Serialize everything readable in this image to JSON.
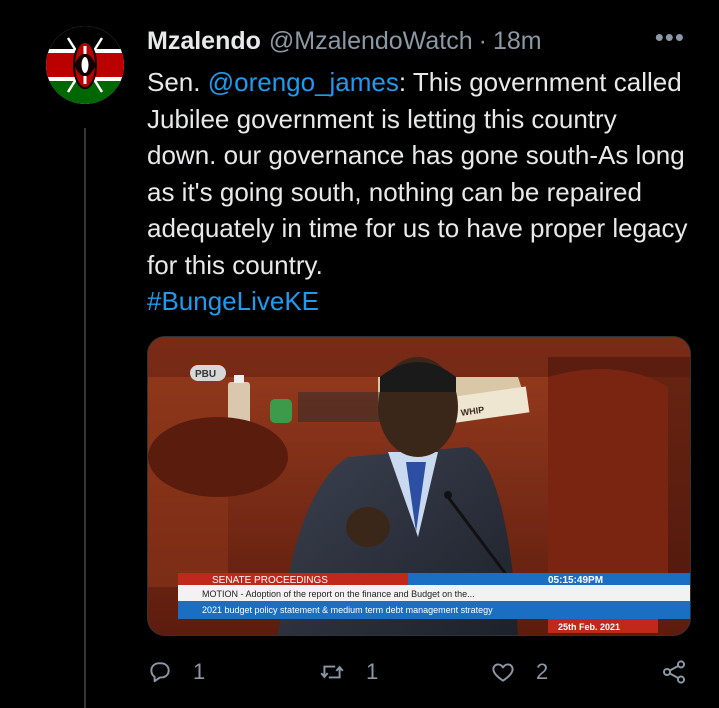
{
  "tweet": {
    "display_name": "Mzalendo",
    "handle": "@MzalendoWatch",
    "separator": "·",
    "time": "18m",
    "more_label": "•••",
    "text_prefix": "Sen. ",
    "mention": "@orengo_james",
    "text_body": ": This government called Jubilee government is letting this country down. our governance has gone south-As long as it's going south, nothing can be repaired adequately in time for us to have proper legacy for this country.",
    "hashtag": "#BungeLiveKE"
  },
  "media": {
    "logo_text": "PBU",
    "desk_label": "WHIP",
    "banner_title": "SENATE PROCEEDINGS",
    "banner_time": "05:15:49PM",
    "banner_motion": "MOTION - Adoption of the report on the finance and Budget on the...",
    "banner_subline": "2021 budget policy statement & medium term debt management strategy",
    "banner_date": "25th Feb. 2021"
  },
  "actions": {
    "reply_count": "1",
    "retweet_count": "1",
    "like_count": "2"
  },
  "colors": {
    "background": "#000000",
    "link": "#1d9bf0",
    "muted": "#8b98a5",
    "banner_red": "#c0281c",
    "banner_blue": "#1b6fc2"
  }
}
